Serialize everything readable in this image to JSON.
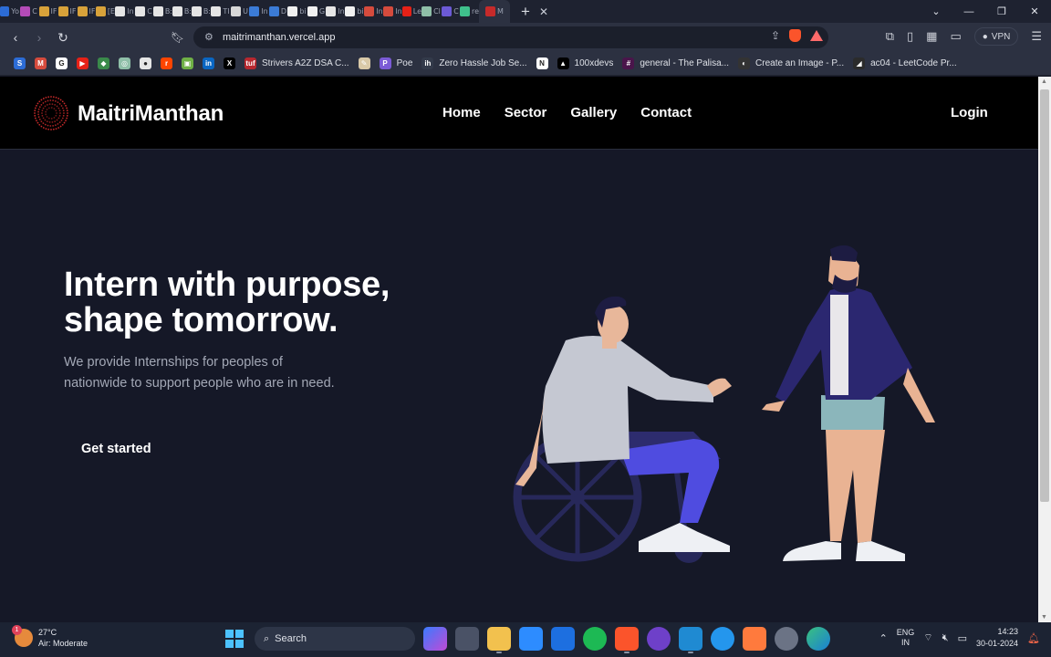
{
  "browser": {
    "tabs": [
      {
        "icon": "S",
        "label": "Yo",
        "color": "#2c6cd6"
      },
      {
        "icon": "",
        "label": "C",
        "color": "#b44bb8"
      },
      {
        "icon": "",
        "label": "IF",
        "color": "#d8a23a"
      },
      {
        "icon": "",
        "label": "IF",
        "color": "#d8a23a"
      },
      {
        "icon": "",
        "label": "IF",
        "color": "#d8a23a"
      },
      {
        "icon": "",
        "label": "[E",
        "color": "#d8a23a"
      },
      {
        "icon": "",
        "label": "In",
        "color": "#e5e5e5"
      },
      {
        "icon": "",
        "label": "C",
        "color": "#e5e5e5"
      },
      {
        "icon": "",
        "label": "B:",
        "color": "#e5e5e5"
      },
      {
        "icon": "",
        "label": "B:",
        "color": "#e5e5e5"
      },
      {
        "icon": "",
        "label": "B:",
        "color": "#e5e5e5"
      },
      {
        "icon": "",
        "label": "TI",
        "color": "#e5e5e5"
      },
      {
        "icon": "",
        "label": "U",
        "color": "#d7d7d7"
      },
      {
        "icon": "",
        "label": "In",
        "color": "#3b7bd6"
      },
      {
        "icon": "",
        "label": "D",
        "color": "#3b7bd6"
      },
      {
        "icon": "",
        "label": "bi",
        "color": "#f0f0f0"
      },
      {
        "icon": "",
        "label": "G",
        "color": "#f0f0f0"
      },
      {
        "icon": "",
        "label": "In",
        "color": "#e6e6e6"
      },
      {
        "icon": "",
        "label": "bi",
        "color": "#f0f0f0"
      },
      {
        "icon": "",
        "label": "In",
        "color": "#d54b3d"
      },
      {
        "icon": "",
        "label": "In",
        "color": "#d54b3d"
      },
      {
        "icon": "",
        "label": "Le",
        "color": "#e62117"
      },
      {
        "icon": "",
        "label": "Cl",
        "color": "#8fbfa8"
      },
      {
        "icon": "",
        "label": "C",
        "color": "#6c5ad6"
      },
      {
        "icon": "",
        "label": "re",
        "color": "#3fc08c"
      }
    ],
    "active_tab": {
      "label": "M",
      "color": "#1b1f2b"
    },
    "url": "maitrimanthan.vercel.app",
    "vpn_label": "VPN",
    "bookmarks": [
      {
        "label": "",
        "icon": "S",
        "color": "#2c6cd6"
      },
      {
        "label": "",
        "icon": "M",
        "color": "#d54b3d"
      },
      {
        "label": "",
        "icon": "G",
        "color": "#ffffff"
      },
      {
        "label": "",
        "icon": "▶",
        "color": "#e62117"
      },
      {
        "label": "",
        "icon": "◆",
        "color": "#3a8a4a"
      },
      {
        "label": "",
        "icon": "◎",
        "color": "#8fbfa8"
      },
      {
        "label": "",
        "icon": "●",
        "color": "#e6e6e6"
      },
      {
        "label": "",
        "icon": "r",
        "color": "#ff4500"
      },
      {
        "label": "",
        "icon": "▣",
        "color": "#6fb046"
      },
      {
        "label": "",
        "icon": "in",
        "color": "#0a66c2"
      },
      {
        "label": "",
        "icon": "X",
        "color": "#000000"
      },
      {
        "label": "Strivers A2Z DSA C...",
        "icon": "tuf",
        "color": "#b8282f"
      },
      {
        "label": "",
        "icon": "✎",
        "color": "#d9c9a8"
      },
      {
        "label": "Poe",
        "icon": "P",
        "color": "#7b5bd6"
      },
      {
        "label": "Zero Hassle Job Se...",
        "icon": "ih",
        "color": "#333a4a"
      },
      {
        "label": "",
        "icon": "N",
        "color": "#ffffff"
      },
      {
        "label": "100xdevs",
        "icon": "▲",
        "color": "#000000"
      },
      {
        "label": "general - The Palisa...",
        "icon": "#",
        "color": "#4a154b"
      },
      {
        "label": "Create an Image - P...",
        "icon": "◐",
        "color": "#333333"
      },
      {
        "label": "ac04 - LeetCode Pr...",
        "icon": "◢",
        "color": "#2b2b2b"
      }
    ]
  },
  "site": {
    "brand": "MaitriManthan",
    "nav": [
      {
        "label": "Home"
      },
      {
        "label": "Sector"
      },
      {
        "label": "Gallery"
      },
      {
        "label": "Contact"
      }
    ],
    "login_label": "Login",
    "hero": {
      "title_line1": "Intern with purpose,",
      "title_line2": "shape tomorrow.",
      "subtitle_line1": "We provide Internships for peoples of",
      "subtitle_line2": "nationwide to support people who are in need.",
      "cta_label": "Get started"
    },
    "colors": {
      "header_bg": "#000000",
      "hero_bg": "#151827",
      "logo_accent": "#c62a2a"
    }
  },
  "taskbar": {
    "weather_temp": "27°C",
    "weather_desc": "Air: Moderate",
    "weather_badge": "1",
    "search_label": "Search",
    "lang_line1": "ENG",
    "lang_line2": "IN",
    "time": "14:23",
    "date": "30-01-2024"
  }
}
